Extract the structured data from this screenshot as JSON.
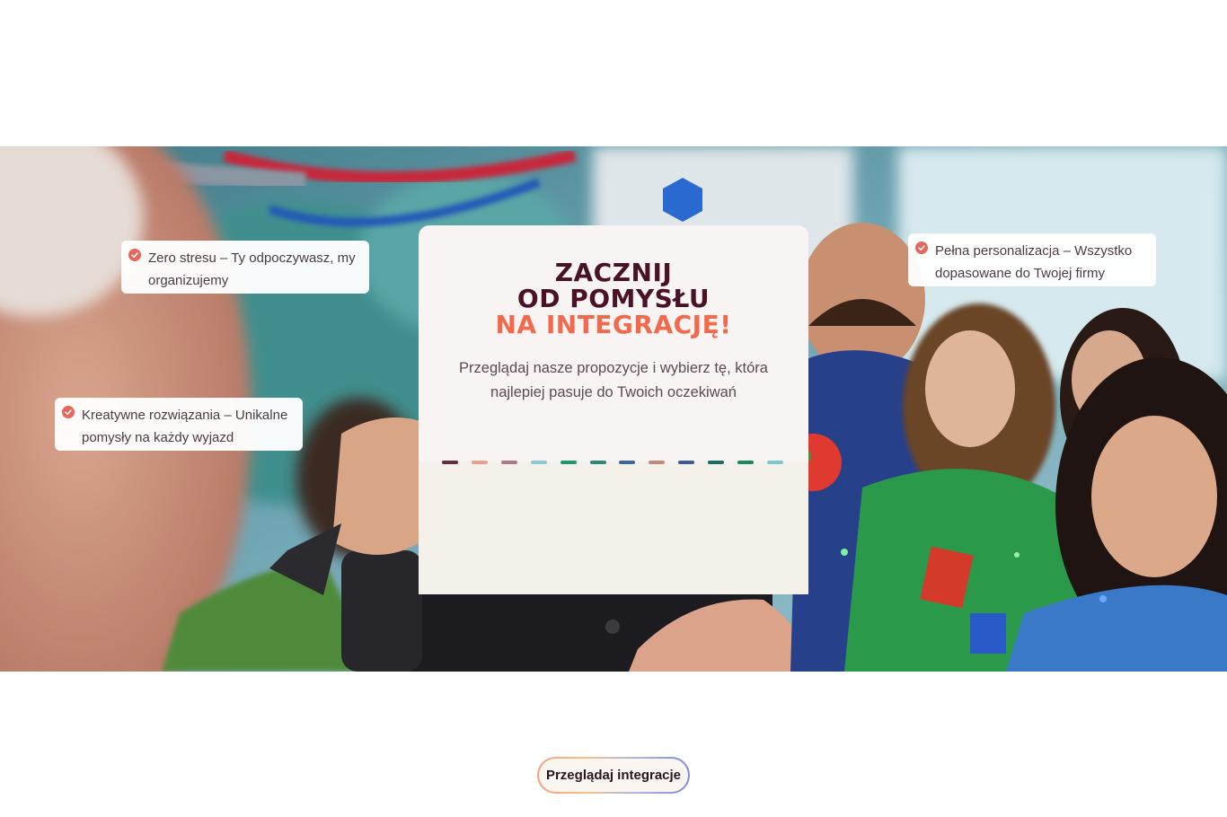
{
  "colors": {
    "headline_dark": "#4a1226",
    "headline_accent": "#f26a4b",
    "check": "#e8665a",
    "card_top": "#f8f4f3",
    "card_bottom": "#f4f0ea"
  },
  "hero": {
    "headline_line1": "ZACZNIJ",
    "headline_line2": "OD POMYSŁU",
    "headline_line3": "NA INTEGRACJĘ!",
    "description": "Przeglądaj nasze propozycje i wybierz tę, która najlepiej pasuje do Twoich oczekiwań",
    "cta_label": "Przeglądaj integracje"
  },
  "features": [
    {
      "text": "Zero stresu – Ty odpoczywasz, my organizujemy",
      "icon": "check-icon"
    },
    {
      "text": "Pełna personalizacja – Wszystko dopasowane do Twojej firmy",
      "icon": "check-icon"
    },
    {
      "text": "Kreatywne rozwiązania – Unikalne pomysły na każdy wyjazd",
      "icon": "check-icon"
    }
  ],
  "perforation_colors": [
    "#6a2a3a",
    "#e8a28a",
    "#b07888",
    "#8cc8d8",
    "#1a9a6a",
    "#2a8a7a",
    "#3a6a9a",
    "#c48878",
    "#3a5a9a",
    "#1a6a6a",
    "#1a8a5a",
    "#7ac8d0"
  ]
}
